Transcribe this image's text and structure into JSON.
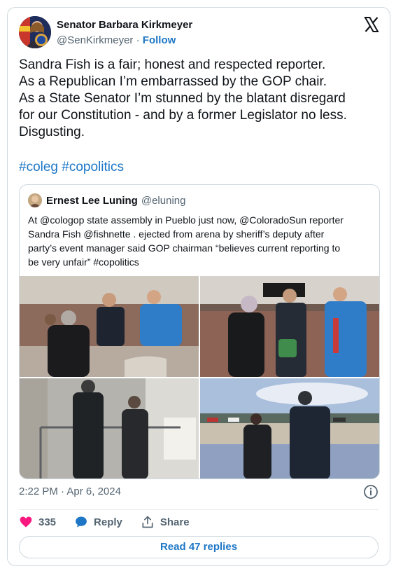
{
  "author": {
    "name": "Senator Barbara Kirkmeyer",
    "handle": "@SenKirkmeyer",
    "separator": "·",
    "follow_label": "Follow"
  },
  "tweet": {
    "lines": [
      "Sandra Fish is a fair; honest and respected reporter.",
      "As a Republican I’m embarrassed by the GOP chair.",
      "As a State Senator I’m stunned by the blatant disregard",
      "for our Constitution - and by a former Legislator no less.",
      "Disgusting."
    ],
    "hashtags": [
      "#coleg",
      "#copolitics"
    ]
  },
  "quoted": {
    "name": "Ernest Lee Luning",
    "handle": "@eluning",
    "lines": [
      "At @cologop state assembly in Pueblo just now, @ColoradoSun reporter",
      "Sandra Fish @fishnette . ejected from arena by sheriff’s deputy after",
      "party’s event manager said GOP chairman “believes current reporting to",
      "be very unfair” #copolitics"
    ]
  },
  "meta": {
    "time": "2:22 PM",
    "separator": "·",
    "date": "Apr 6, 2024"
  },
  "actions": {
    "likes": "335",
    "reply_label": "Reply",
    "share_label": "Share"
  },
  "read_replies_label": "Read 47 replies",
  "colors": {
    "accent": "#1d77c6",
    "like": "#f91880",
    "border": "#cfd9de",
    "muted": "#536471"
  }
}
